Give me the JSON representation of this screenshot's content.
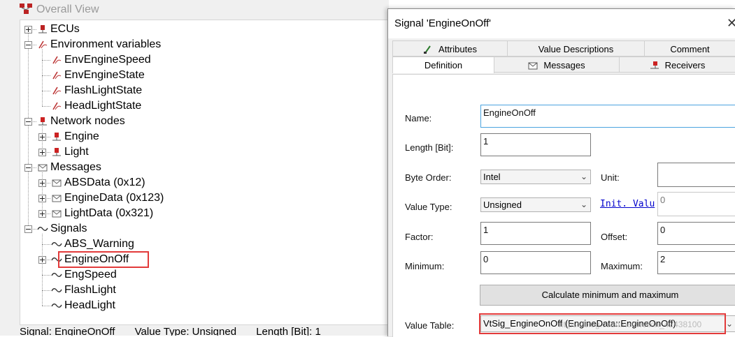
{
  "left_panel": {
    "title": "Overall View",
    "tree": [
      {
        "label": "ECUs",
        "icon": "ecu-icon"
      },
      {
        "label": "Environment variables",
        "icon": "envvar-icon"
      },
      {
        "label": "EnvEngineSpeed",
        "icon": "envvar-icon"
      },
      {
        "label": "EnvEngineState",
        "icon": "envvar-icon"
      },
      {
        "label": "FlashLightState",
        "icon": "envvar-icon"
      },
      {
        "label": "HeadLightState",
        "icon": "envvar-icon"
      },
      {
        "label": "Network nodes",
        "icon": "node-icon"
      },
      {
        "label": "Engine",
        "icon": "node-icon"
      },
      {
        "label": "Light",
        "icon": "node-icon"
      },
      {
        "label": "Messages",
        "icon": "message-icon"
      },
      {
        "label": "ABSData (0x12)",
        "icon": "message-icon"
      },
      {
        "label": "EngineData (0x123)",
        "icon": "message-icon"
      },
      {
        "label": "LightData (0x321)",
        "icon": "message-icon"
      },
      {
        "label": "Signals",
        "icon": "signal-icon"
      },
      {
        "label": "ABS_Warning",
        "icon": "signal-icon"
      },
      {
        "label": "EngineOnOff",
        "icon": "signal-icon"
      },
      {
        "label": "EngSpeed",
        "icon": "signal-icon"
      },
      {
        "label": "FlashLight",
        "icon": "signal-icon"
      },
      {
        "label": "HeadLight",
        "icon": "signal-icon"
      }
    ],
    "status": {
      "signal": "Signal: EngineOnOff",
      "value_type": "Value Type: Unsigned",
      "length": "Length [Bit]: 1"
    }
  },
  "dialog": {
    "title": "Signal 'EngineOnOff'",
    "close_glyph": "✕",
    "tabs_row1": [
      "Attributes",
      "Value Descriptions",
      "Comment"
    ],
    "tabs_row2": [
      "Definition",
      "Messages",
      "Receivers"
    ],
    "active_tab": "Definition",
    "fields": {
      "name_label": "Name:",
      "name_value": "EngineOnOff",
      "length_label": "Length [Bit]:",
      "length_value": "1",
      "byte_order_label": "Byte Order:",
      "byte_order_value": "Intel",
      "unit_label": "Unit:",
      "unit_value": "",
      "value_type_label": "Value Type:",
      "value_type_value": "Unsigned",
      "init_value_label": "Init. Valu",
      "init_value_value": "0",
      "factor_label": "Factor:",
      "factor_value": "1",
      "offset_label": "Offset:",
      "offset_value": "0",
      "minimum_label": "Minimum:",
      "minimum_value": "0",
      "maximum_label": "Maximum:",
      "maximum_value": "2",
      "calc_button": "Calculate minimum and maximum",
      "value_table_label": "Value Table:",
      "value_table_value": "VtSig_EngineOnOff (EngineData::EngineOnOff)"
    },
    "watermark": "https://blog.csdn.net/weixin_42438100"
  },
  "colors": {
    "highlight_box": "#e23a3a",
    "link": "#0000cc",
    "focus_border": "#4aa3df"
  }
}
